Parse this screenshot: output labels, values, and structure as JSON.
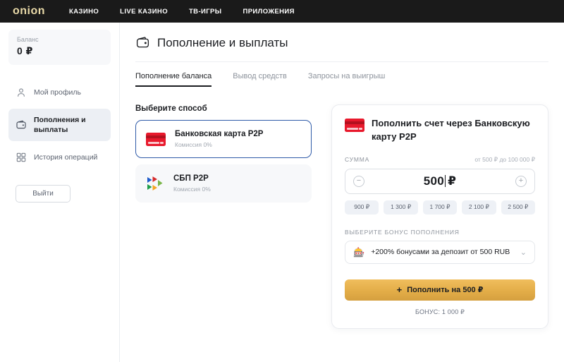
{
  "brand": {
    "logo_text": "onion",
    "logo_color": "#e8d9a8"
  },
  "topnav": {
    "items": [
      {
        "label": "КАЗИНО"
      },
      {
        "label": "LIVE КАЗИНО"
      },
      {
        "label": "ТВ-ИГРЫ"
      },
      {
        "label": "ПРИЛОЖЕНИЯ"
      }
    ]
  },
  "sidebar": {
    "balance": {
      "label": "Баланс",
      "value": "0 ₽"
    },
    "items": [
      {
        "label": "Мой профиль",
        "icon": "user-icon",
        "active": false
      },
      {
        "label": "Пополнения и выплаты",
        "icon": "wallet-icon",
        "active": true
      },
      {
        "label": "История операций",
        "icon": "grid-icon",
        "active": false
      }
    ],
    "logout_label": "Выйти"
  },
  "page": {
    "title": "Пополнение и выплаты",
    "title_icon": "wallet-icon",
    "tabs": [
      {
        "label": "Пополнение баланса",
        "active": true
      },
      {
        "label": "Вывод средств",
        "active": false
      },
      {
        "label": "Запросы на выигрыш",
        "active": false
      }
    ]
  },
  "methods": {
    "section_title": "Выберите способ",
    "items": [
      {
        "name": "Банковская карта P2P",
        "fee": "Комиссия 0%",
        "icon": "bank-card-icon",
        "selected": true
      },
      {
        "name": "СБП P2P",
        "fee": "Комиссия 0%",
        "icon": "sbp-icon",
        "selected": false
      }
    ]
  },
  "deposit": {
    "title": "Пополнить счет через Банковскую карту P2P",
    "title_icon": "bank-card-icon",
    "amount_label": "СУММА",
    "amount_hint": "от 500 ₽ до 100 000 ₽",
    "amount_value": "500",
    "amount_currency": "₽",
    "decrement_icon": "minus-circle-icon",
    "increment_icon": "plus-circle-icon",
    "quick_amounts": [
      "900 ₽",
      "1 300 ₽",
      "1 700 ₽",
      "2 100 ₽",
      "2 500 ₽"
    ],
    "bonus_label": "ВЫБЕРИТЕ БОНУС ПОПОЛНЕНИЯ",
    "bonus_emoji": "🎰",
    "bonus_option": "+200% бонусами за депозит от 500 RUB",
    "dropdown_icon": "chevron-down-icon",
    "submit_label": "Пополнить на 500 ₽",
    "submit_icon": "plus-icon",
    "bonus_note": "БОНУС: 1 000 ₽"
  },
  "colors": {
    "accent_gold": "#e3ad48",
    "topbar_bg": "#1a1a1a",
    "selected_border": "#2f5ba8",
    "card_red": "#e8192c"
  }
}
